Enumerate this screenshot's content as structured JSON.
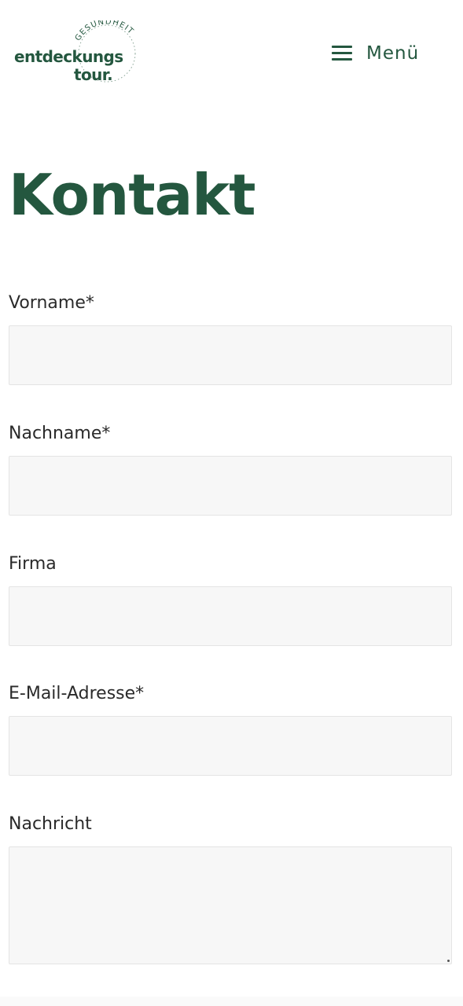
{
  "header": {
    "logo": {
      "arc_text": "GESUNDHEIT",
      "line1": "entdeckungs",
      "line2": "tour."
    },
    "menu_label": "Menü",
    "menu_icon": "hamburger-icon"
  },
  "main": {
    "title": "Kontakt"
  },
  "form": {
    "fields": [
      {
        "label": "Vorname*",
        "value": "",
        "placeholder": ""
      },
      {
        "label": "Nachname*",
        "value": "",
        "placeholder": ""
      },
      {
        "label": "Firma",
        "value": "",
        "placeholder": ""
      },
      {
        "label": "E-Mail-Adresse*",
        "value": "",
        "placeholder": ""
      },
      {
        "label": "Nachricht",
        "value": "",
        "placeholder": ""
      }
    ]
  },
  "colors": {
    "brand_green": "#24573f",
    "input_background": "#f7f7f7",
    "input_border": "#e4e4e4",
    "label_text": "#2a2a2a"
  }
}
